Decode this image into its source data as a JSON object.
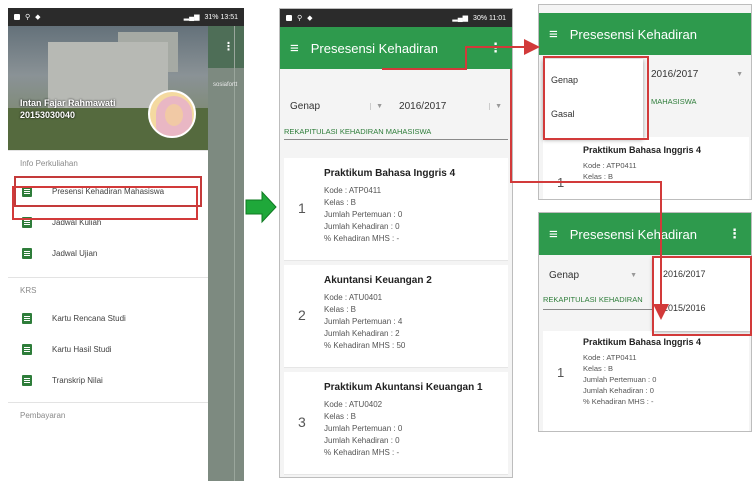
{
  "statusbar": {
    "p1_right": "31%  13:51",
    "p2_right": "30%  11:01"
  },
  "drawer": {
    "user_name": "Intan Fajar Rahmawati",
    "user_nim": "20153030040",
    "sections": [
      {
        "label": "Info Perkuliahan",
        "items": [
          {
            "label": "Presensi Kehadiran Mahasiswa",
            "icon": "clipboard-icon",
            "selected": true
          },
          {
            "label": "Jadwal Kuliah",
            "icon": "calendar-icon"
          },
          {
            "label": "Jadwal Ujian",
            "icon": "calendar-icon"
          }
        ]
      },
      {
        "label": "KRS",
        "items": [
          {
            "label": "Kartu Rencana Studi",
            "icon": "document-icon"
          },
          {
            "label": "Kartu Hasil Studi",
            "icon": "check-document-icon"
          },
          {
            "label": "Transkrip Nilai",
            "icon": "document-icon"
          }
        ]
      }
    ],
    "footer_section": "Pembayaran",
    "behind_hint": "sosiafortt"
  },
  "screen": {
    "title": "Presesensi Kehadiran",
    "semester_value": "Genap",
    "year_value": "2016/2017",
    "rekap_label": "REKAPITULASI KEHADIRAN MAHASISWA",
    "rekap_label_short": "REKAPITULASI KEHADIRAN",
    "rekap_label_tail": "MAHASISWA",
    "semester_options": [
      "Genap",
      "Gasal"
    ],
    "year_options": [
      "2016/2017",
      "2015/2016"
    ]
  },
  "courses": [
    {
      "num": "1",
      "title": "Praktikum Bahasa Inggris 4",
      "kode": "Kode : ATP0411",
      "kelas": "Kelas : B",
      "pertemuan": "Jumlah Pertemuan : 0",
      "kehadiran": "Jumlah Kehadiran : 0",
      "persen": "% Kehadiran MHS : -"
    },
    {
      "num": "2",
      "title": "Akuntansi Keuangan 2",
      "kode": "Kode : ATU0401",
      "kelas": "Kelas : B",
      "pertemuan": "Jumlah Pertemuan : 4",
      "kehadiran": "Jumlah Kehadiran : 2",
      "persen": "% Kehadiran MHS : 50"
    },
    {
      "num": "3",
      "title": "Praktikum Akuntansi Keuangan 1",
      "kode": "Kode : ATU0402",
      "kelas": "Kelas : B",
      "pertemuan": "Jumlah Pertemuan : 0",
      "kehadiran": "Jumlah Kehadiran : 0",
      "persen": "% Kehadiran MHS : -"
    }
  ],
  "colors": {
    "appbar": "#2e9a4d",
    "highlight": "#d23a3a",
    "arrow": "#1fa83a"
  }
}
